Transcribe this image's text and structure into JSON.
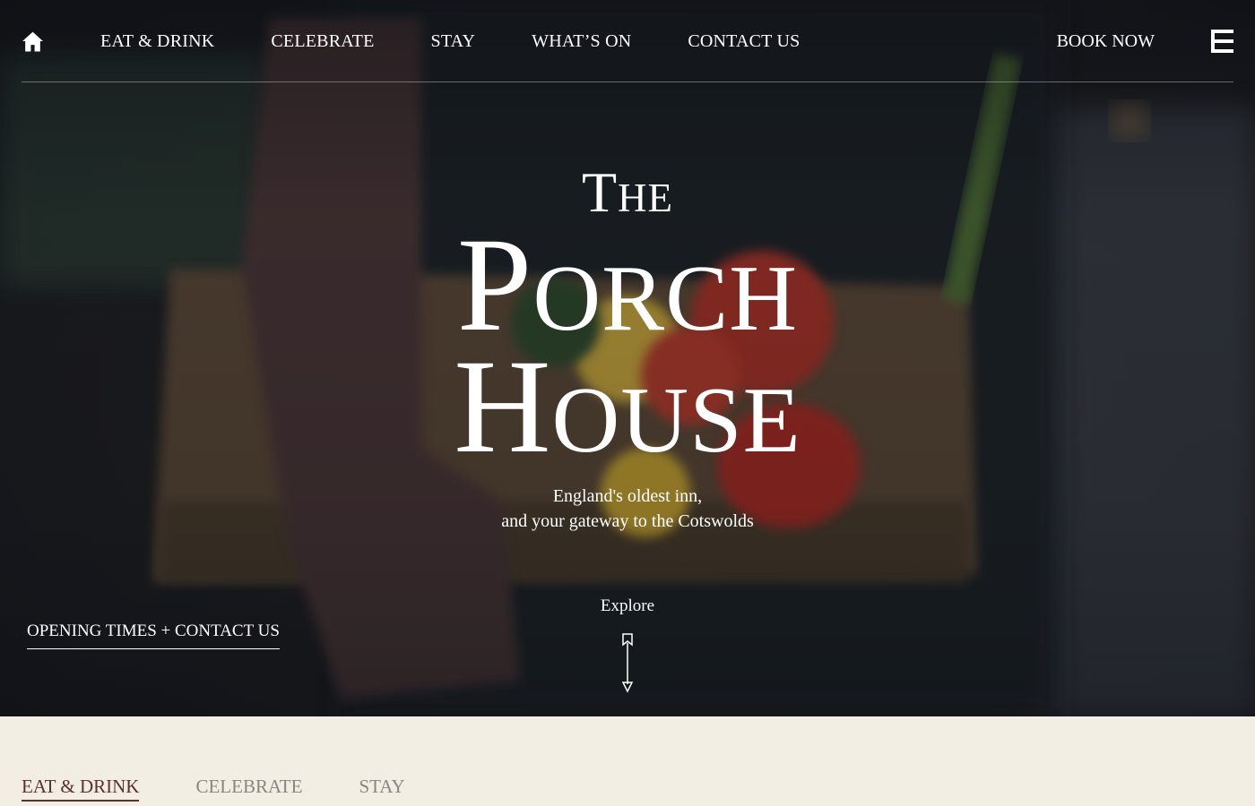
{
  "nav": {
    "home_icon": "home-icon",
    "links": [
      "EAT & DRINK",
      "CELEBRATE",
      "STAY",
      "WHAT’S ON",
      "CONTACT US"
    ],
    "book_now": "BOOK NOW",
    "menu_icon": "hamburger-menu-icon"
  },
  "hero": {
    "title_the": "The",
    "title_line1": "Porch",
    "title_line2": "House",
    "tagline_line1": "England's oldest inn,",
    "tagline_line2": "and your gateway to the Cotswolds",
    "explore": "Explore",
    "explore_icon": "arrow-down-icon",
    "opening_link": "OPENING TIMES + CONTACT US"
  },
  "tabs": {
    "items": [
      "EAT & DRINK",
      "CELEBRATE",
      "STAY"
    ],
    "active_index": 0
  },
  "colors": {
    "accent": "#5b2f34",
    "cream": "#f2eee3",
    "inactive_tab": "#8a8580"
  }
}
